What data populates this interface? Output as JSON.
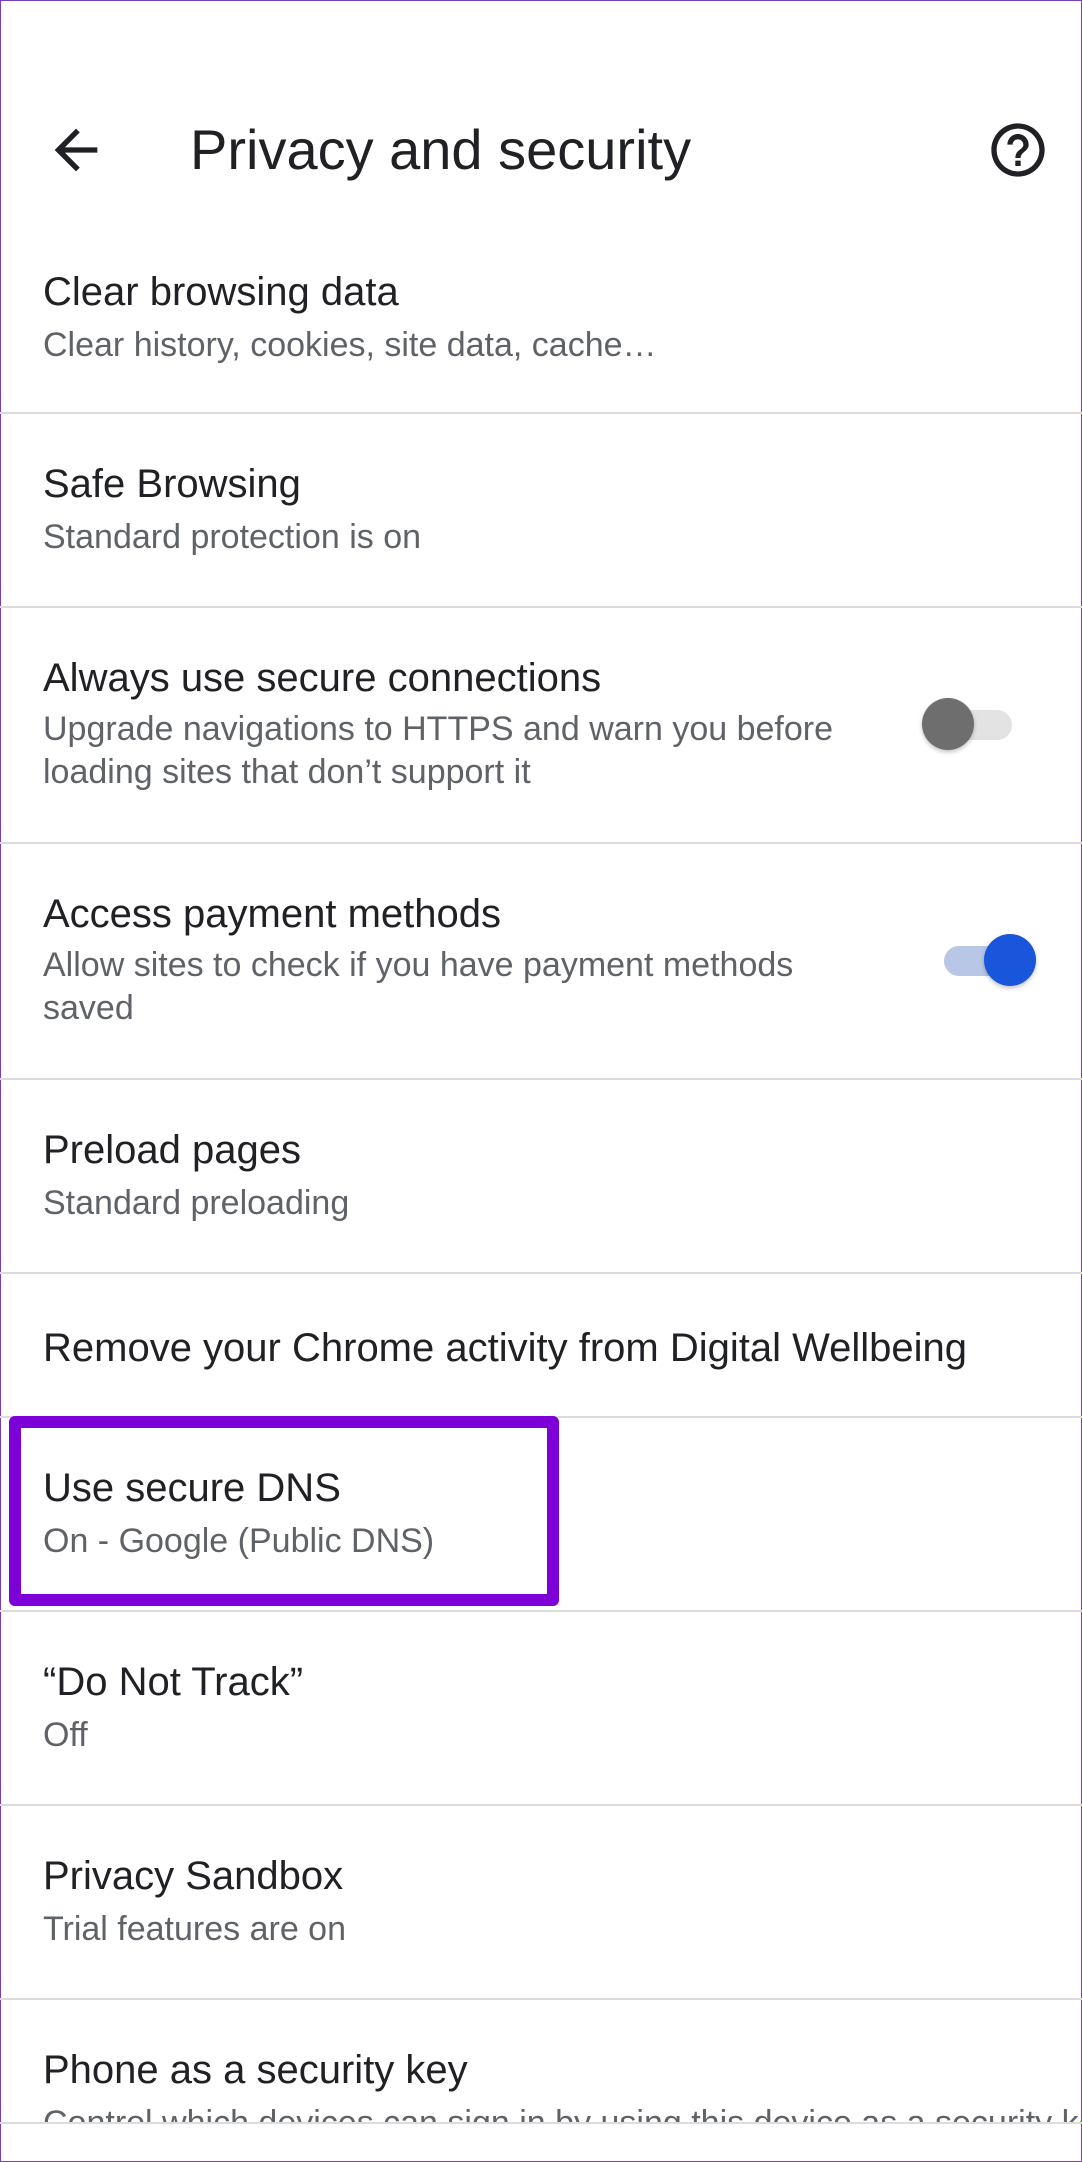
{
  "header": {
    "title": "Privacy and security",
    "back_icon": "arrow-back-icon",
    "help_icon": "help-circle-icon"
  },
  "settings": [
    {
      "label": "Clear browsing data",
      "sub": "Clear history, cookies, site data, cache…"
    },
    {
      "label": "Safe Browsing",
      "sub": "Standard protection is on"
    },
    {
      "label": "Always use secure connections",
      "sub": "Upgrade navigations to HTTPS and warn you before loading sites that don’t support it",
      "toggle": "off"
    },
    {
      "label": "Access payment methods",
      "sub": "Allow sites to check if you have payment methods saved",
      "toggle": "on"
    },
    {
      "label": "Preload pages",
      "sub": "Standard preloading"
    },
    {
      "label": "Remove your Chrome activity from Digital Wellbeing"
    },
    {
      "label": "Use secure DNS",
      "sub": "On - Google (Public DNS)"
    },
    {
      "label": "“Do Not Track”",
      "sub": "Off"
    },
    {
      "label": "Privacy Sandbox",
      "sub": "Trial features are on"
    },
    {
      "label": "Phone as a security key",
      "sub": "Control which devices can sign in by using this device as a security key"
    }
  ],
  "colors": {
    "accent": "#1a56db",
    "highlight": "#7e00d8",
    "text_primary": "#202124",
    "text_secondary": "#5f6368"
  }
}
